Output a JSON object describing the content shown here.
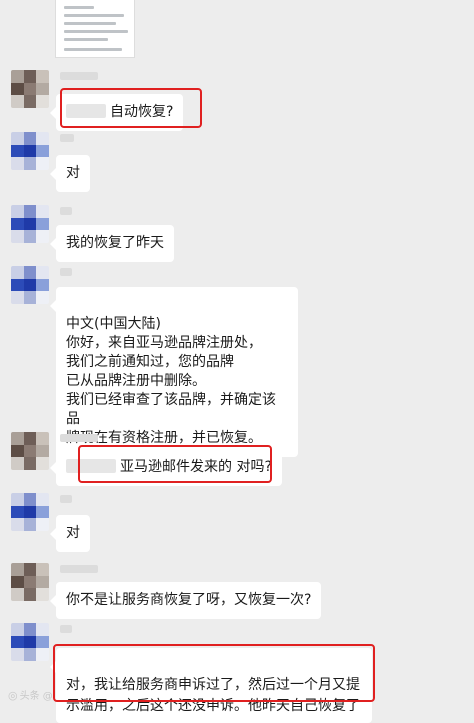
{
  "watermark": "头条 @",
  "messages": [
    {
      "id": "m1",
      "sender": "customer",
      "text": "自动恢复?"
    },
    {
      "id": "m2",
      "sender": "agent",
      "text": "对"
    },
    {
      "id": "m3",
      "sender": "agent",
      "text": "我的恢复了昨天"
    },
    {
      "id": "m4",
      "sender": "agent",
      "text": "中文(中国大陆)\n你好，来自亚马逊品牌注册处，\n我们之前通知过，您的品牌\n已从品牌注册中删除。\n我们已经审查了该品牌，并确定该品\n牌现在有资格注册，并已恢复。"
    },
    {
      "id": "m5",
      "sender": "customer",
      "text": "亚马逊邮件发来的 对吗?"
    },
    {
      "id": "m6",
      "sender": "agent",
      "text": "对"
    },
    {
      "id": "m7",
      "sender": "customer",
      "text": "你不是让服务商恢复了呀，又恢复一次?"
    },
    {
      "id": "m8",
      "sender": "agent",
      "text": "对，我让给服务商申诉过了，然后过一个月又提\n示滥用，之后这个还没申诉。他昨天自己恢复了"
    }
  ],
  "colors": {
    "background": "#ededed",
    "bubble": "#ffffff",
    "highlight": "#e02020"
  }
}
